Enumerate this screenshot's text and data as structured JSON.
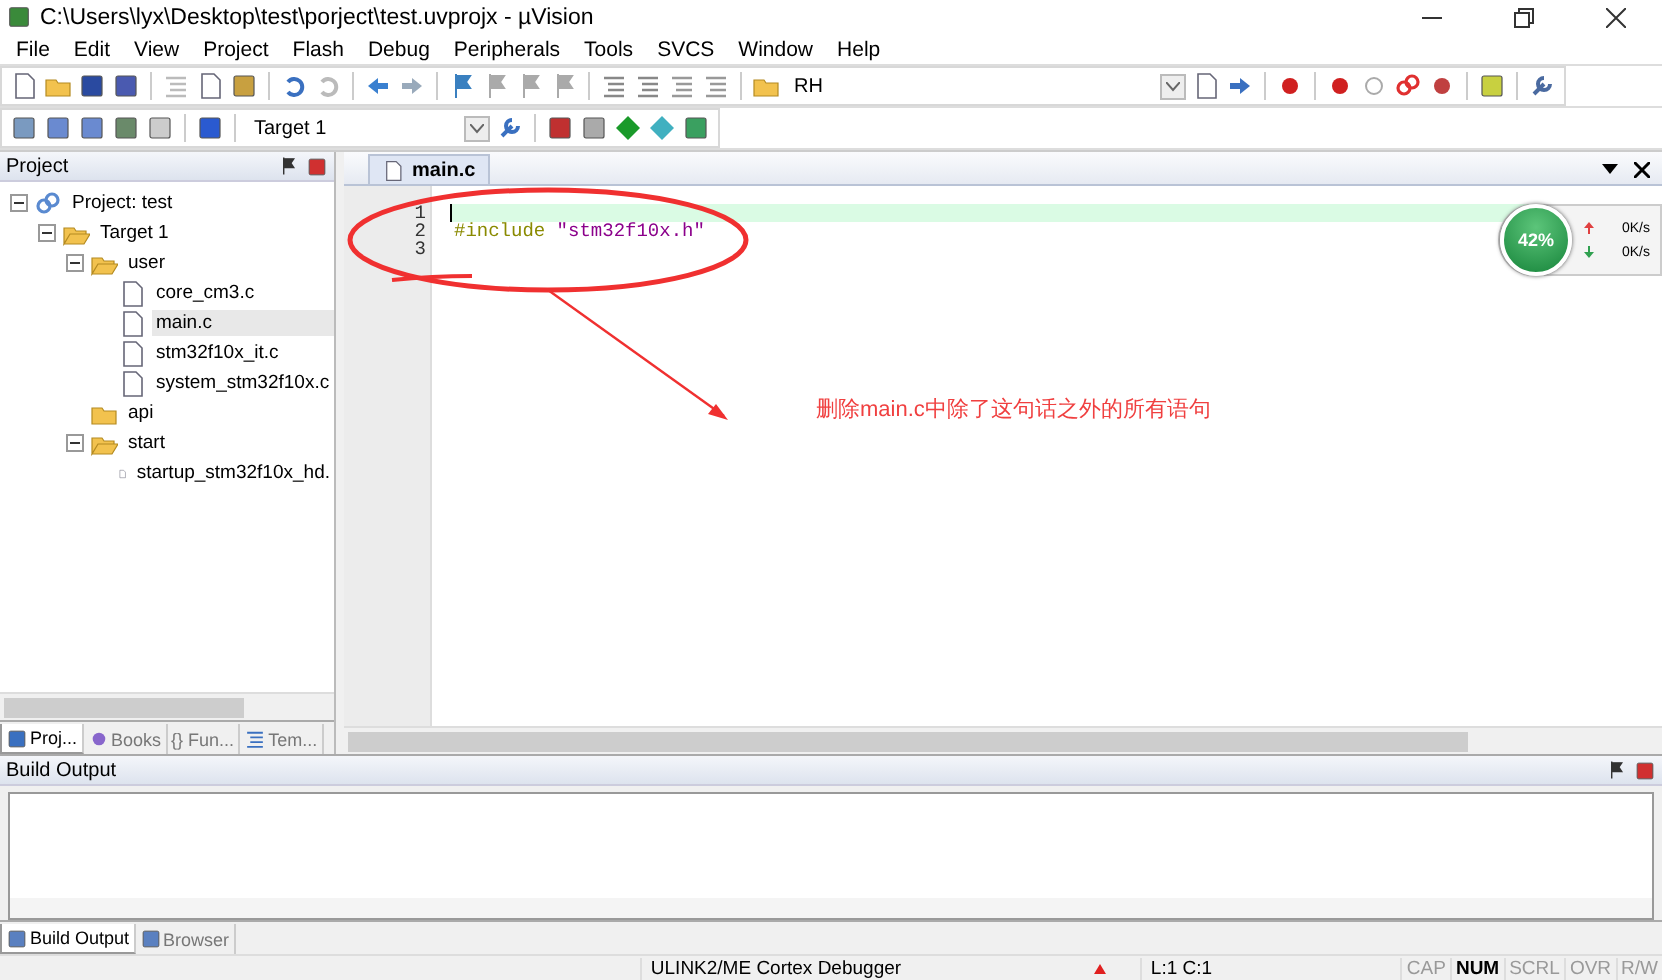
{
  "window": {
    "title": "C:\\Users\\lyx\\Desktop\\test\\porject\\test.uvprojx - µVision"
  },
  "menu": [
    "File",
    "Edit",
    "View",
    "Project",
    "Flash",
    "Debug",
    "Peripherals",
    "Tools",
    "SVCS",
    "Window",
    "Help"
  ],
  "toolbar": {
    "find_field": {
      "value": "RH"
    },
    "target_select": {
      "value": "Target 1"
    }
  },
  "project_panel": {
    "title": "Project",
    "tree": [
      {
        "label": "Project: test",
        "kind": "project",
        "expanded": true,
        "selected": false,
        "children": [
          {
            "label": "Target 1",
            "kind": "target",
            "expanded": true,
            "selected": false,
            "children": [
              {
                "label": "user",
                "kind": "folder",
                "expanded": true,
                "selected": false,
                "children": [
                  {
                    "label": "core_cm3.c",
                    "kind": "file",
                    "selected": false
                  },
                  {
                    "label": "main.c",
                    "kind": "file",
                    "selected": true
                  },
                  {
                    "label": "stm32f10x_it.c",
                    "kind": "file",
                    "selected": false
                  },
                  {
                    "label": "system_stm32f10x.c",
                    "kind": "file",
                    "selected": false
                  }
                ]
              },
              {
                "label": "api",
                "kind": "folder",
                "selected": false
              },
              {
                "label": "start",
                "kind": "folder",
                "expanded": true,
                "selected": false,
                "children": [
                  {
                    "label": "startup_stm32f10x_hd.",
                    "kind": "file",
                    "selected": false
                  }
                ]
              }
            ]
          }
        ]
      }
    ],
    "tabs": [
      {
        "label": "Proj...",
        "kind": "project",
        "selected": true
      },
      {
        "label": "Books",
        "kind": "books",
        "selected": false
      },
      {
        "label": "{} Fun...",
        "kind": "functions",
        "selected": false
      },
      {
        "label": "Tem...",
        "kind": "templates",
        "selected": false
      }
    ]
  },
  "editor": {
    "tabs": [
      {
        "label": "main.c",
        "selected": true
      }
    ],
    "lines": [
      {
        "number": "1",
        "selected": true
      },
      {
        "number": "2",
        "selected": false,
        "segments": [
          {
            "kind": "directive",
            "text": "#include"
          },
          {
            "kind": "string",
            "text": "\"stm32f10x.h\""
          }
        ]
      },
      {
        "number": "3",
        "selected": false
      }
    ]
  },
  "annotation": {
    "note": "删除main.c中除了这句话之外的所有语句"
  },
  "net_meter": {
    "percent": "42%",
    "upload": "0K/s",
    "download": "0K/s"
  },
  "build_output": {
    "title": "Build Output",
    "tabs": [
      {
        "label": "Build Output",
        "selected": true
      },
      {
        "label": "Browser",
        "selected": false
      }
    ]
  },
  "status_bar": {
    "debugger": "ULINK2/ME Cortex Debugger",
    "position": "L:1 C:1",
    "indicators": [
      {
        "label": "CAP",
        "on": false
      },
      {
        "label": "NUM",
        "on": true
      },
      {
        "label": "SCRL",
        "on": false
      },
      {
        "label": "OVR",
        "on": false
      },
      {
        "label": "R/W",
        "on": false
      }
    ]
  }
}
